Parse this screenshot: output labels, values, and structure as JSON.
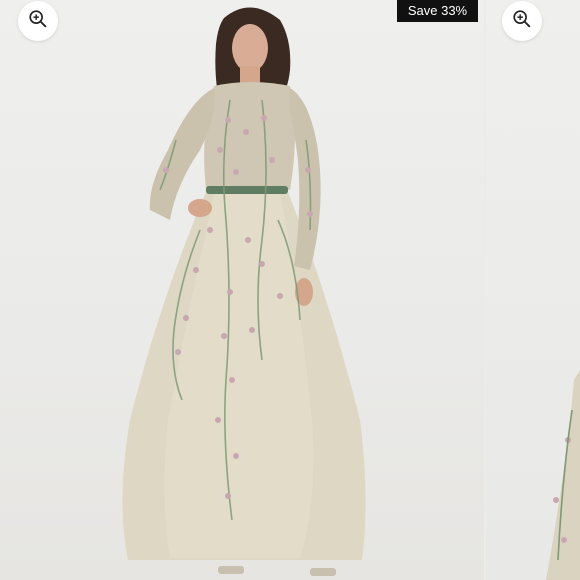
{
  "gallery": {
    "badge_text": "Save 33%",
    "accent_color": "#111111",
    "zoom_icon": "zoom-in-icon",
    "images": [
      {
        "subject": "model-in-embroidered-gown"
      },
      {
        "subject": "gown-detail-partial"
      }
    ]
  }
}
